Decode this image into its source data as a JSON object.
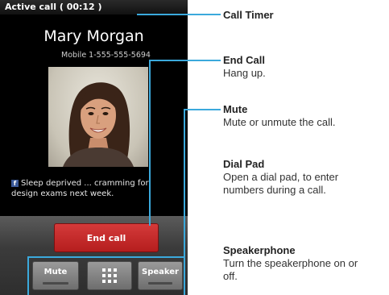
{
  "status_bar": {
    "text": "Active call ( 00:12 )"
  },
  "caller": {
    "name": "Mary Morgan",
    "number": "Mobile 1-555-555-5694"
  },
  "social": {
    "icon": "facebook-icon",
    "line1": "Sleep deprived ... cramming for",
    "line2": "design exams next week."
  },
  "buttons": {
    "end_call": "End call",
    "mute": "Mute",
    "dial_pad_icon": "dialpad-grid-icon",
    "speaker": "Speaker"
  },
  "callouts": {
    "call_timer": {
      "title": "Call Timer"
    },
    "end_call": {
      "title": "End Call",
      "desc": "Hang up."
    },
    "mute": {
      "title": "Mute",
      "desc": "Mute or unmute the call."
    },
    "dial_pad": {
      "title": "Dial Pad",
      "desc1": "Open a dial pad, to enter",
      "desc2": "numbers during a call."
    },
    "speakerphone": {
      "title": "Speakerphone",
      "desc1": "Turn the speakerphone on or",
      "desc2": "off."
    }
  },
  "colors": {
    "callout_line": "#3ba9dc",
    "end_call": "#c62828",
    "facebook": "#3b5998"
  }
}
